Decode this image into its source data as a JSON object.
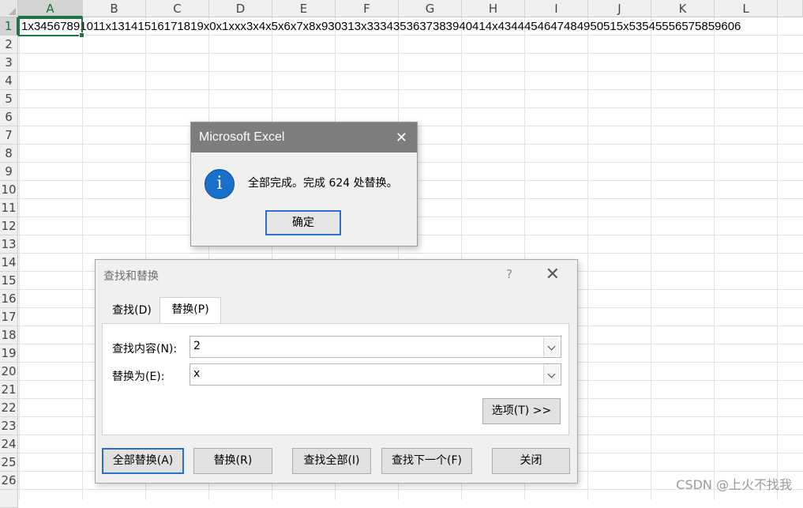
{
  "sheet": {
    "columns": [
      "A",
      "B",
      "C",
      "D",
      "E",
      "F",
      "G",
      "H",
      "I",
      "J",
      "K",
      "L"
    ],
    "rows": [
      "1",
      "2",
      "3",
      "4",
      "5",
      "6",
      "7",
      "8",
      "9",
      "10",
      "11",
      "12",
      "13",
      "14",
      "15",
      "16",
      "17",
      "18",
      "19",
      "20",
      "21",
      "22",
      "23",
      "24",
      "25",
      "26"
    ],
    "cell_a1": "1x34567891011x131415161718​19x0x1xxx3x4x5x6x7x8x930313x33343536373839404​14x434445464748495051​5x53545556575859606"
  },
  "msgbox": {
    "title": "Microsoft Excel",
    "close_glyph": "✕",
    "icon_glyph": "i",
    "message": "全部完成。完成 624 处替换。",
    "ok_label": "确定"
  },
  "find_replace": {
    "title": "查找和替换",
    "help_glyph": "?",
    "close_glyph": "✕",
    "tab_find": "查找(D)",
    "tab_replace": "替换(P)",
    "find_label": "查找内容(N):",
    "find_value": "2",
    "replace_label": "替换为(E):",
    "replace_value": "x",
    "options_label": "选项(T) >>",
    "replace_all_label": "全部替换(A)",
    "replace_label_btn": "替换(R)",
    "find_all_label": "查找全部(I)",
    "find_next_label": "查找下一个(F)",
    "close_label": "关闭"
  },
  "watermark": "CSDN @上火不找我"
}
